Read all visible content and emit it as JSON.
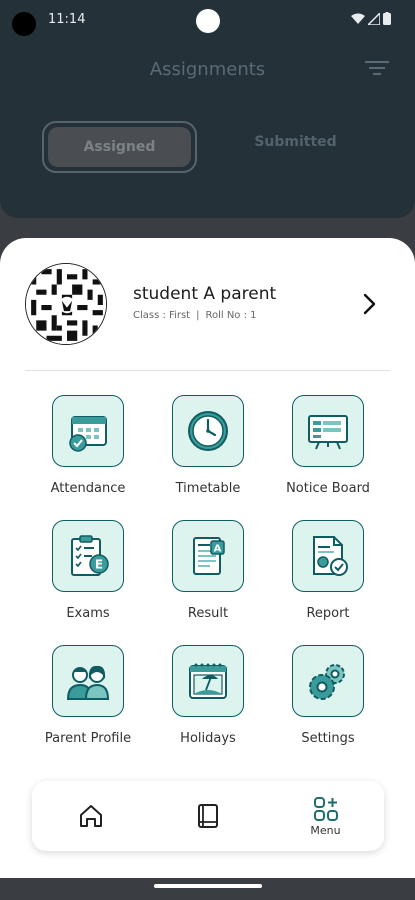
{
  "status_bar": {
    "time": "11:14"
  },
  "header": {
    "title": "Assignments",
    "tabs": [
      {
        "label": "Assigned"
      },
      {
        "label": "Submitted"
      }
    ]
  },
  "profile": {
    "name": "student A parent",
    "class": "Class : First",
    "roll": "Roll No : 1"
  },
  "menu": {
    "items": [
      {
        "label": "Attendance",
        "icon": "calendar-check-icon"
      },
      {
        "label": "Timetable",
        "icon": "clock-icon"
      },
      {
        "label": "Notice Board",
        "icon": "notice-board-icon"
      },
      {
        "label": "Exams",
        "icon": "exam-clipboard-icon"
      },
      {
        "label": "Result",
        "icon": "result-document-icon"
      },
      {
        "label": "Report",
        "icon": "report-icon"
      },
      {
        "label": "Parent Profile",
        "icon": "parents-icon"
      },
      {
        "label": "Holidays",
        "icon": "holiday-calendar-icon"
      },
      {
        "label": "Settings",
        "icon": "gears-icon"
      }
    ]
  },
  "bottom_nav": {
    "home_icon": "home-icon",
    "book_icon": "book-icon",
    "menu_label": "Menu"
  },
  "colors": {
    "accent": "#0f5c62",
    "tile_bg": "#dcf3ee",
    "header_bg": "#243139"
  }
}
